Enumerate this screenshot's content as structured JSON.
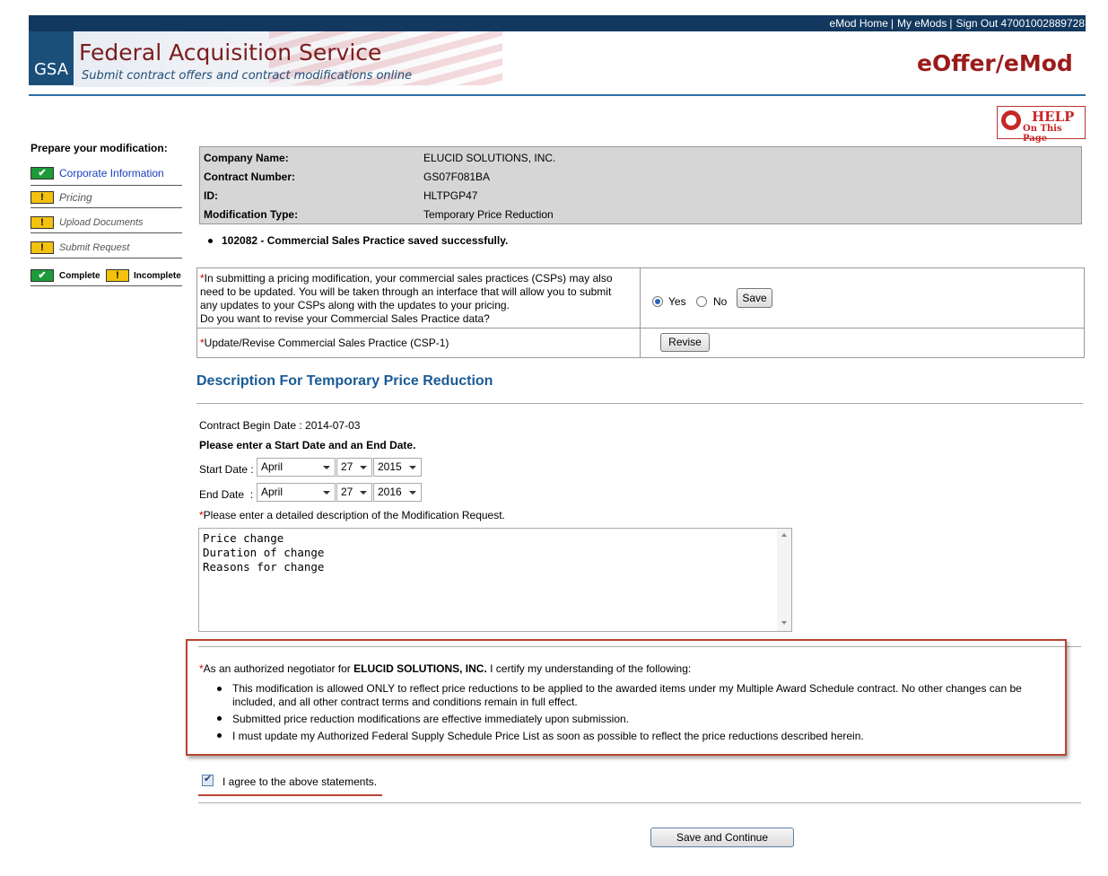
{
  "header": {
    "links": [
      "eMod Home",
      "My eMods",
      "Sign Out 47001002889728"
    ],
    "logo": "GSA",
    "title": "Federal Acquisition Service",
    "subtitle": "Submit contract offers and contract modifications online",
    "app_name": "eOffer/eMod",
    "help_line1": "HELP",
    "help_line2": "On This Page"
  },
  "sidebar": {
    "heading": "Prepare your modification:",
    "items": [
      {
        "label": "Corporate Information",
        "status": "complete"
      },
      {
        "label": "Pricing",
        "status": "incomplete"
      },
      {
        "label": "Upload Documents",
        "status": "incomplete"
      },
      {
        "label": "Submit Request",
        "status": "incomplete"
      }
    ],
    "legend_complete": "Complete",
    "legend_incomplete": "Incomplete"
  },
  "info": {
    "company_label": "Company Name:",
    "company": "ELUCID SOLUTIONS, INC.",
    "contract_label": "Contract Number:",
    "contract": "GS07F081BA",
    "id_label": "ID:",
    "id": "HLTPGP47",
    "modtype_label": "Modification Type:",
    "modtype": "Temporary Price Reduction"
  },
  "message": "102082 - Commercial Sales Practice saved successfully.",
  "csp": {
    "question_lines": [
      "In submitting a pricing modification, your commercial sales practices (CSPs) may also",
      "need to be updated. You will be taken through an interface that will allow you to submit",
      "any updates to your CSPs along with the updates to your pricing.",
      "Do you want to revise your Commercial Sales Practice data?"
    ],
    "yes": "Yes",
    "no": "No",
    "selected": "Yes",
    "save": "Save",
    "update_label": "Update/Revise Commercial Sales Practice (CSP-1)",
    "revise": "Revise"
  },
  "description": {
    "title": "Description For Temporary Price Reduction",
    "contract_begin": "Contract Begin Date : 2014-07-03",
    "enter_dates": "Please enter a Start Date and an End Date.",
    "start_label": "Start Date :",
    "start_month": "April",
    "start_day": "27",
    "start_year": "2015",
    "end_label": "End Date  :",
    "end_month": "April",
    "end_day": "27",
    "end_year": "2016",
    "detail_prompt": "Please enter a detailed description of the Modification Request.",
    "text": "Price change\nDuration of change\nReasons for change"
  },
  "certification": {
    "intro_pre": "As an authorized negotiator for ",
    "company": "ELUCID SOLUTIONS, INC.",
    "intro_post": " I certify my understanding of the following:",
    "bullets": [
      "This modification is allowed ONLY to reflect price reductions to be applied to the awarded items under my Multiple Award Schedule contract. No other changes can be",
      "included, and all other contract terms and conditions remain in full effect.",
      "Submitted price reduction modifications are effective immediately upon submission.",
      "I must update my Authorized Federal Supply Schedule Price List as soon as possible to reflect the price reductions described herein."
    ],
    "agree": "I agree to the above statements.",
    "agreed": true
  },
  "actions": {
    "save_continue": "Save and Continue"
  },
  "colors": {
    "navy": "#12385f",
    "brand_red": "#9b1b1b",
    "title_blue": "#1a5a96",
    "highlight": "#b84433"
  }
}
